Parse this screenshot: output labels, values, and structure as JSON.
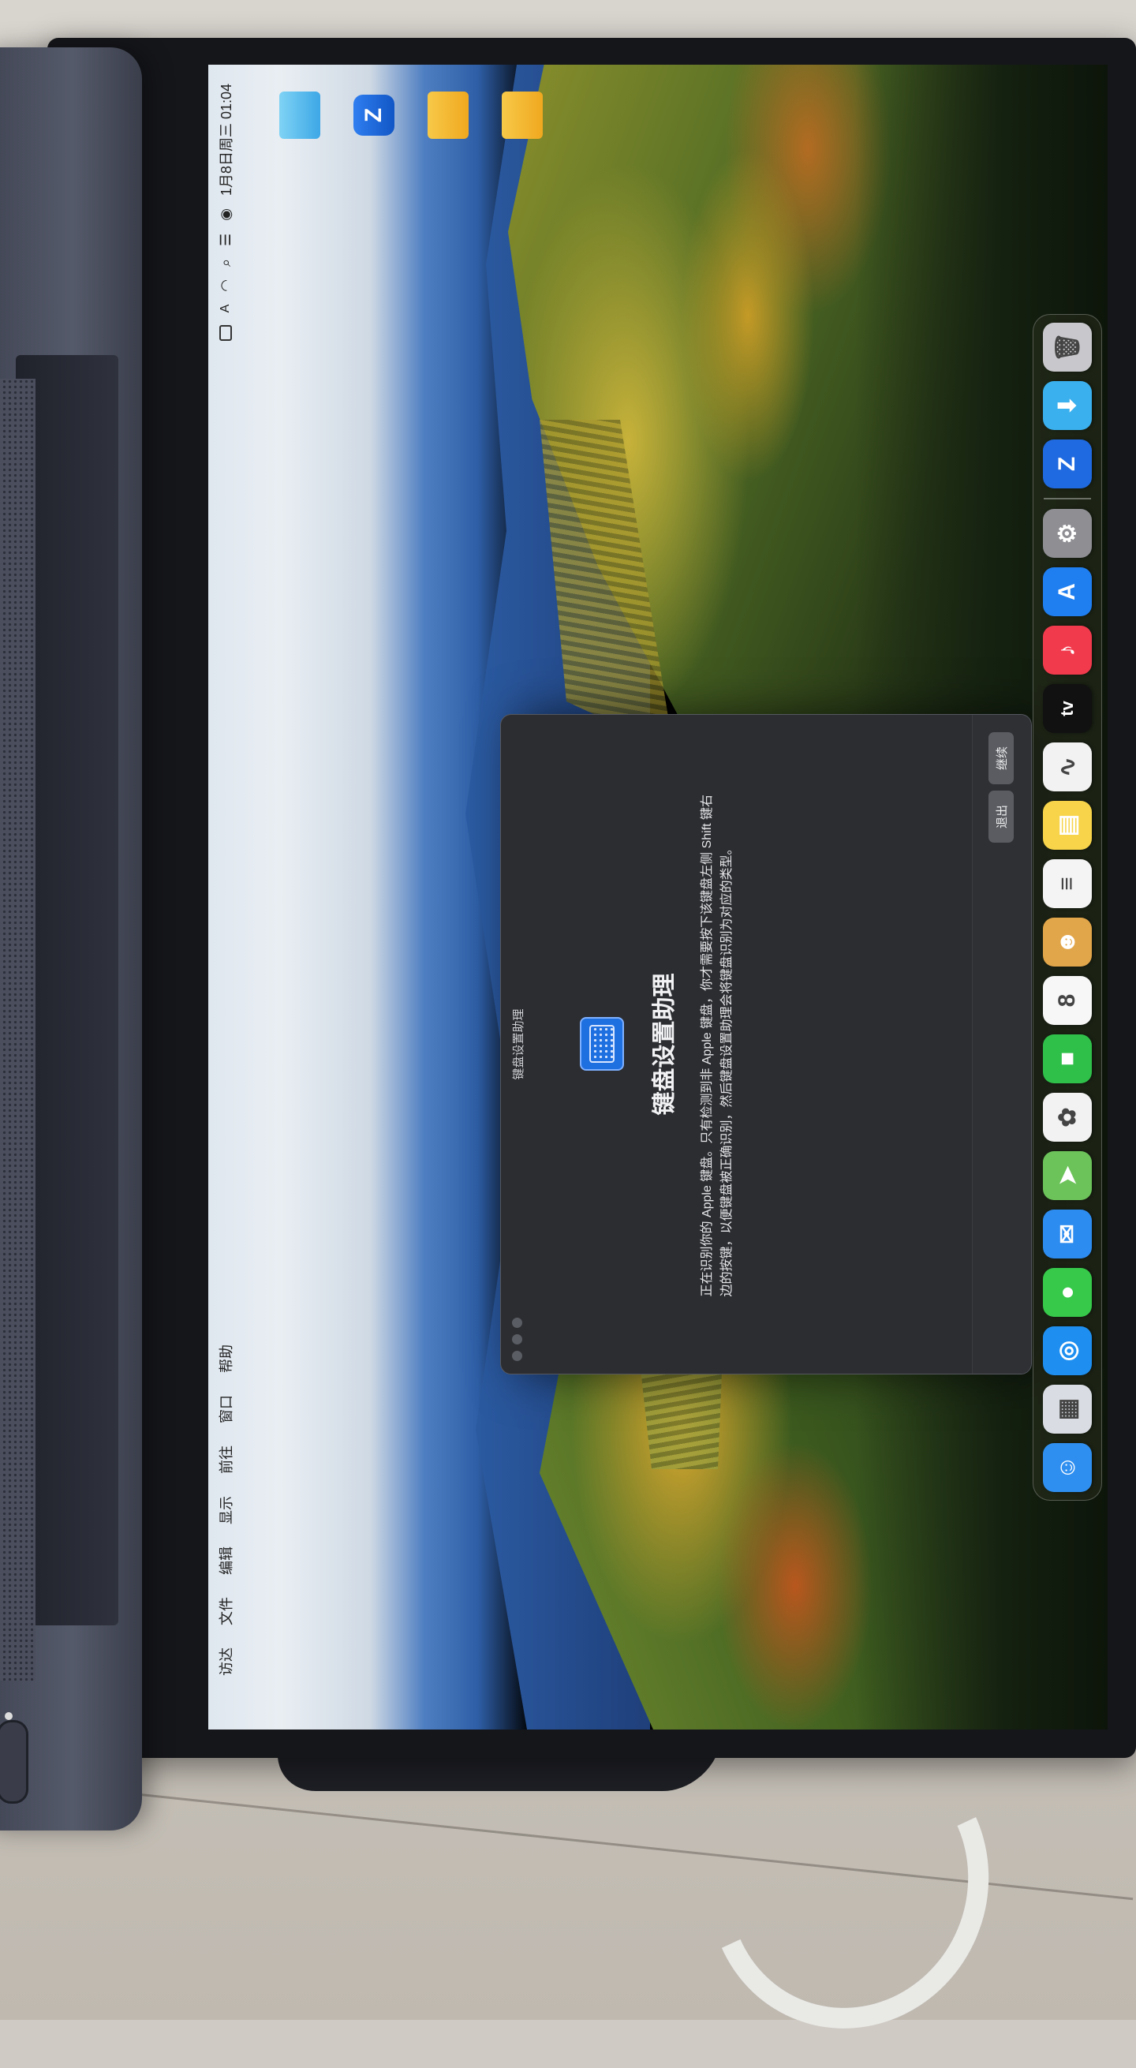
{
  "menubar": {
    "apple_icon": "apple-icon",
    "items": [
      "访达",
      "文件",
      "编辑",
      "显示",
      "前往",
      "窗口",
      "帮助"
    ],
    "status_text": "1月8日周三 01:04"
  },
  "desktop": {
    "icons": [
      {
        "label": "",
        "icon": "folder-blue-icon"
      },
      {
        "label": "",
        "icon": "zapp-icon"
      },
      {
        "label": "",
        "icon": "folder-icon"
      },
      {
        "label": "",
        "icon": "folder-icon"
      }
    ]
  },
  "dock": {
    "apps": [
      {
        "name": "finder",
        "glyph": "☺",
        "color": "#2f8ff0"
      },
      {
        "name": "launchpad",
        "glyph": "▦",
        "color": "#d9dde3"
      },
      {
        "name": "safari",
        "glyph": "◎",
        "color": "#1e8ff0"
      },
      {
        "name": "messages",
        "glyph": "●",
        "color": "#36c94a"
      },
      {
        "name": "mail",
        "glyph": "✉",
        "color": "#2d8cf0"
      },
      {
        "name": "maps",
        "glyph": "➤",
        "color": "#6cc35a"
      },
      {
        "name": "photos",
        "glyph": "✿",
        "color": "#f2f2f2"
      },
      {
        "name": "facetime",
        "glyph": "■",
        "color": "#2fc04a"
      },
      {
        "name": "calendar",
        "glyph": "8",
        "color": "#f7f7f7"
      },
      {
        "name": "contacts",
        "glyph": "☻",
        "color": "#e2a64a"
      },
      {
        "name": "reminders",
        "glyph": "≡",
        "color": "#f4f4f4"
      },
      {
        "name": "notes",
        "glyph": "▤",
        "color": "#f7d44a"
      },
      {
        "name": "freeform",
        "glyph": "∿",
        "color": "#f2f2f2"
      },
      {
        "name": "tv",
        "glyph": "tv",
        "color": "#111111"
      },
      {
        "name": "music",
        "glyph": "♪",
        "color": "#f23a4d"
      },
      {
        "name": "app-store",
        "glyph": "A",
        "color": "#1f7ef0"
      },
      {
        "name": "system-settings",
        "glyph": "⚙",
        "color": "#8e8e93"
      },
      {
        "name": "zapp",
        "glyph": "Z",
        "color": "#1f6ae0"
      },
      {
        "name": "downloads",
        "glyph": "⬇",
        "color": "#3ab0ee"
      },
      {
        "name": "trash",
        "glyph": "🗑",
        "color": "#c8c8cc"
      }
    ]
  },
  "window": {
    "title": "键盘设置助理",
    "heading": "键盘设置助理",
    "body": "正在识别你的 Apple 键盘。只有检测到非 Apple 键盘，你才需要按下该键盘左侧 Shift 键右边的按键，以便键盘被正确识别，然后键盘设置助理会将键盘识别为对应的类型。",
    "buttons": [
      "退出",
      "继续"
    ]
  }
}
